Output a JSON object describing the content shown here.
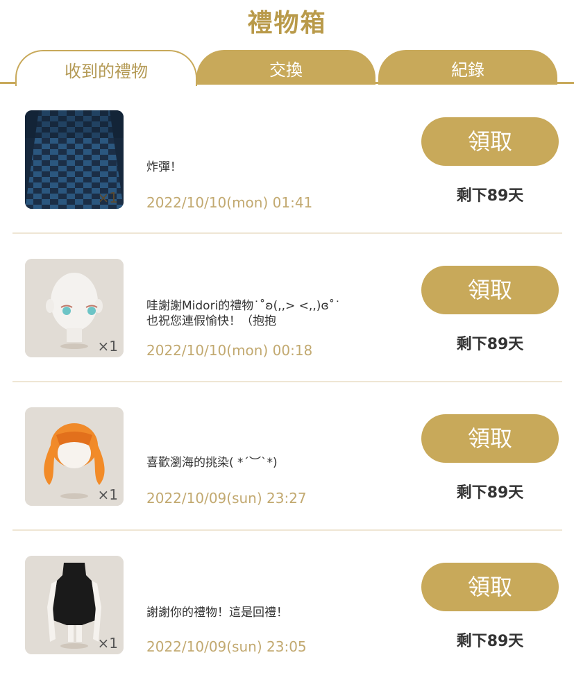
{
  "page": {
    "title": "禮物箱"
  },
  "tabs": [
    {
      "label": "收到的禮物",
      "active": true
    },
    {
      "label": "交換",
      "active": false
    },
    {
      "label": "紀錄",
      "active": false
    }
  ],
  "gifts": [
    {
      "thumb": "checker-floor",
      "qty": "×1",
      "message": "炸彈！",
      "date": "2022/10/10(mon) 01:41",
      "claim": "領取",
      "remain": "剩下89天"
    },
    {
      "thumb": "bald-head",
      "qty": "×1",
      "message": "哇謝謝Midori的禮物˙˚ʚ(,,> <,,)ɞ˚˙\n也祝您連假愉快！（抱抱",
      "date": "2022/10/10(mon) 00:18",
      "claim": "領取",
      "remain": "剩下89天"
    },
    {
      "thumb": "orange-hair",
      "qty": "×1",
      "message": "喜歡瀏海的挑染( *´︶`*)",
      "date": "2022/10/09(sun) 23:27",
      "claim": "領取",
      "remain": "剩下89天"
    },
    {
      "thumb": "black-dress",
      "qty": "×1",
      "message": "謝謝你的禮物！這是回禮！",
      "date": "2022/10/09(sun) 23:05",
      "claim": "領取",
      "remain": "剩下89天"
    }
  ],
  "colors": {
    "gold": "#c8a95a",
    "date": "#c2a970"
  }
}
